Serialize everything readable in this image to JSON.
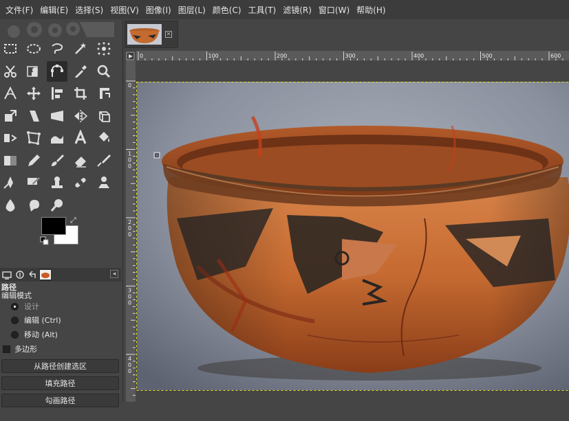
{
  "menubar": {
    "items": [
      "文件(F)",
      "编辑(E)",
      "选择(S)",
      "视图(V)",
      "图像(I)",
      "图层(L)",
      "颜色(C)",
      "工具(T)",
      "滤镜(R)",
      "窗口(W)",
      "帮助(H)"
    ]
  },
  "toolbox": {
    "tools": [
      "rect-select-icon",
      "ellipse-select-icon",
      "free-select-icon",
      "fuzzy-select-icon",
      "color-select-icon",
      "scissors-select-icon",
      "foreground-select-icon",
      "paths-icon",
      "color-picker-icon",
      "zoom-icon",
      "measure-icon",
      "move-icon",
      "align-icon",
      "crop-icon",
      "rotate-icon",
      "scale-icon",
      "shear-icon",
      "perspective-icon",
      "flip-icon",
      "3d-transform-icon",
      "warp-transform-icon",
      "cage-transform-icon",
      "warp-icon",
      "text-icon",
      "bucket-fill-icon",
      "gradient-icon",
      "pencil-icon",
      "paintbrush-icon",
      "eraser-icon",
      "airbrush-icon",
      "ink-icon",
      "mypaint-brush-icon",
      "clone-icon",
      "heal-icon",
      "perspective-clone-icon",
      "blur-icon",
      "smudge-icon",
      "dodge-burn-icon"
    ],
    "active_tool": "paths-icon",
    "foreground_color": "#000000",
    "background_color": "#ffffff"
  },
  "tool_options": {
    "title": "路径",
    "subtitle": "编辑模式",
    "modes": [
      {
        "label": "设计",
        "selected": true
      },
      {
        "label": "编辑 (Ctrl)",
        "selected": false
      },
      {
        "label": "移动 (Alt)",
        "selected": false
      }
    ],
    "polygonal_label": "多边形",
    "buttons": [
      "从路径创建选区",
      "填充路径",
      "勾画路径"
    ]
  },
  "image_window": {
    "ruler_h": [
      "0",
      "100",
      "200",
      "300",
      "400",
      "500",
      "600"
    ],
    "ruler_v": [
      "0",
      "100",
      "200",
      "300",
      "400"
    ]
  }
}
